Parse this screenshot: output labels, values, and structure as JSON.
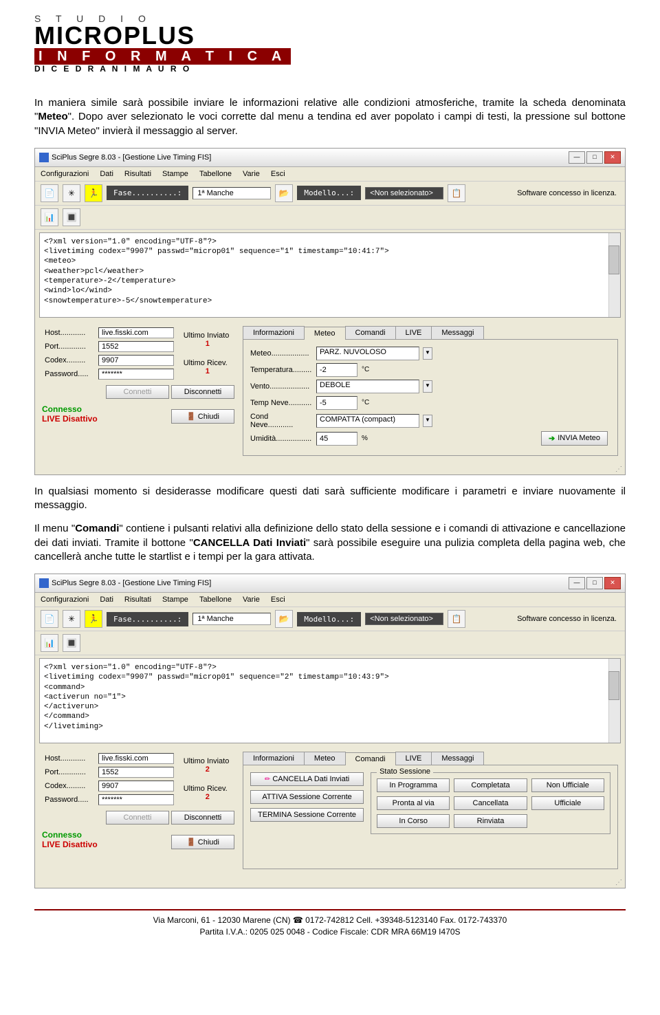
{
  "logo": {
    "studio": "S T U D I O",
    "main": "MICROPLUS",
    "info": "I N F O R M A T I C A",
    "sub": "DI  C E D R A N I  M A U R O"
  },
  "paragraphs": {
    "p1a": "In maniera simile sarà possibile inviare le informazioni relative alle condizioni atmosferiche, tramite la scheda denominata \"",
    "p1_bold": "Meteo",
    "p1b": "\". Dopo aver selezionato le voci corrette dal menu a tendina ed aver popolato i campi di testi, la pressione sul bottone \"INVIA Meteo\" invierà il messaggio al server.",
    "p2": "In qualsiasi momento si desiderasse modificare questi dati sarà sufficiente modificare i parametri e inviare nuovamente il messaggio.",
    "p3a": "Il menu \"",
    "p3_bold1": "Comandi",
    "p3b": "\" contiene i pulsanti relativi alla definizione dello stato della sessione e i comandi di attivazione e cancellazione dei dati inviati. Tramite il bottone \"",
    "p3_bold2": "CANCELLA Dati Inviati",
    "p3c": "\" sarà possibile eseguire una pulizia completa della pagina web, che cancellerà anche tutte le startlist e i tempi per la gara attivata."
  },
  "window": {
    "title": "SciPlus Segre 8.03 - [Gestione Live Timing FIS]",
    "menus": [
      "Configurazioni",
      "Dati",
      "Risultati",
      "Stampe",
      "Tabellone",
      "Varie",
      "Esci"
    ],
    "license": "Software concesso in licenza.",
    "toolbar": {
      "fase_label": "Fase..........:",
      "fase_value": "1ª Manche",
      "modello_label": "Modello...:",
      "modello_value": "<Non selezionato>"
    }
  },
  "xml1": {
    "lines": [
      "<?xml version=\"1.0\" encoding=\"UTF-8\"?>",
      "<livetiming codex=\"9907\" passwd=\"microp01\" sequence=\"1\" timestamp=\"10:41:7\">",
      "<meteo>",
      "<weather>pcl</weather>",
      "<temperature>-2</temperature>",
      "<wind>lo</wind>",
      "<snowtemperature>-5</snowtemperature>"
    ]
  },
  "xml2": {
    "lines": [
      "<?xml version=\"1.0\" encoding=\"UTF-8\"?>",
      "<livetiming codex=\"9907\" passwd=\"microp01\" sequence=\"2\" timestamp=\"10:43:9\">",
      "<command>",
      "<activerun no=\"1\">",
      "</activerun>",
      "</command>",
      "</livetiming>"
    ]
  },
  "connection": {
    "host_lbl": "Host............",
    "host": "live.fisski.com",
    "port_lbl": "Port.............",
    "port": "1552",
    "codex_lbl": "Codex.........",
    "codex": "9907",
    "password_lbl": "Password.....",
    "password": "*******",
    "ultimo_inviato": "Ultimo Inviato",
    "ultimo_ricev": "Ultimo Ricev.",
    "connetti": "Connetti",
    "disconnetti": "Disconnetti",
    "chiudi": "Chiudi",
    "status_conn": "Connesso",
    "status_live": "LIVE Disattivo"
  },
  "counters": {
    "s1_inv": "1",
    "s1_ric": "1",
    "s2_inv": "2",
    "s2_ric": "2"
  },
  "tabs": [
    "Informazioni",
    "Meteo",
    "Comandi",
    "LIVE",
    "Messaggi"
  ],
  "meteo": {
    "meteo_lbl": "Meteo..................",
    "meteo_val": "PARZ. NUVOLOSO",
    "temp_lbl": "Temperatura.........",
    "temp_val": "-2",
    "temp_unit": "°C",
    "vento_lbl": "Vento...................",
    "vento_val": "DEBOLE",
    "tneve_lbl": "Temp Neve...........",
    "tneve_val": "-5",
    "tneve_unit": "°C",
    "cneve_lbl": "Cond Neve............",
    "cneve_val": "COMPATTA (compact)",
    "umid_lbl": "Umidità.................",
    "umid_val": "45",
    "umid_unit": "%",
    "invia": "INVIA Meteo"
  },
  "comandi": {
    "cancella": "CANCELLA Dati Inviati",
    "attiva": "ATTIVA Sessione Corrente",
    "termina": "TERMINA Sessione Corrente",
    "stato_title": "Stato Sessione",
    "stati": [
      "In Programma",
      "Completata",
      "Non Ufficiale",
      "Pronta al via",
      "Cancellata",
      "Ufficiale",
      "In Corso",
      "Rinviata"
    ]
  },
  "footer": {
    "line1a": "Via Marconi, 61 - 12030 Marene (CN) ",
    "line1b": " 0172-742812 Cell. +39348-5123140 Fax. 0172-743370",
    "line2": "Partita I.V.A.: 0205 025 0048 - Codice Fiscale: CDR MRA 66M19 I470S"
  }
}
